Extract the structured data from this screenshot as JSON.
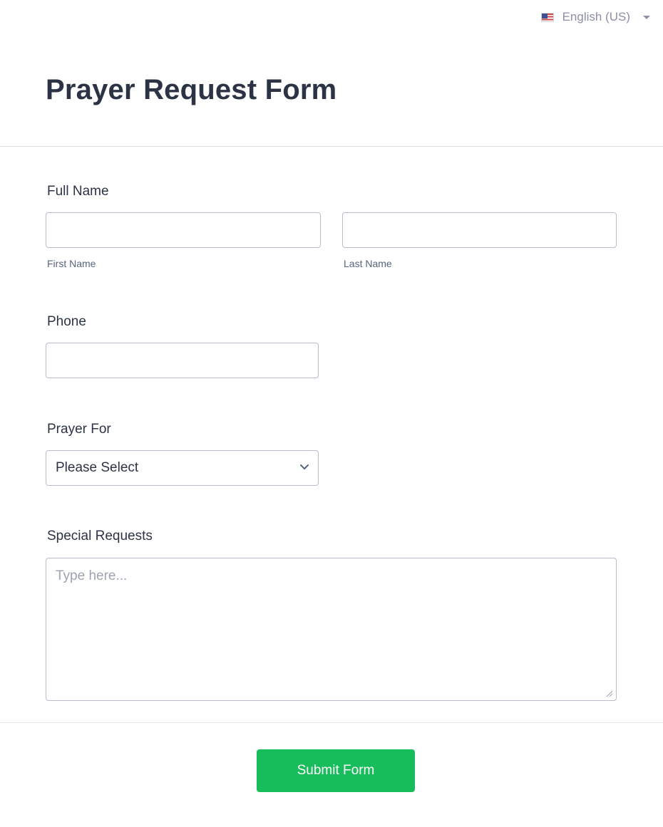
{
  "language": {
    "flag_icon": "us-flag-icon",
    "label": "English (US)"
  },
  "form": {
    "title": "Prayer Request Form",
    "full_name": {
      "label": "Full Name",
      "first": {
        "value": "",
        "sublabel": "First Name"
      },
      "last": {
        "value": "",
        "sublabel": "Last Name"
      }
    },
    "phone": {
      "label": "Phone",
      "value": ""
    },
    "prayer_for": {
      "label": "Prayer For",
      "selected": "Please Select"
    },
    "special_requests": {
      "label": "Special Requests",
      "placeholder": "Type here..."
    },
    "submit_label": "Submit Form"
  },
  "colors": {
    "submit_bg": "#18bd5b",
    "text": "#2c3345",
    "border": "#b8bdc9"
  }
}
